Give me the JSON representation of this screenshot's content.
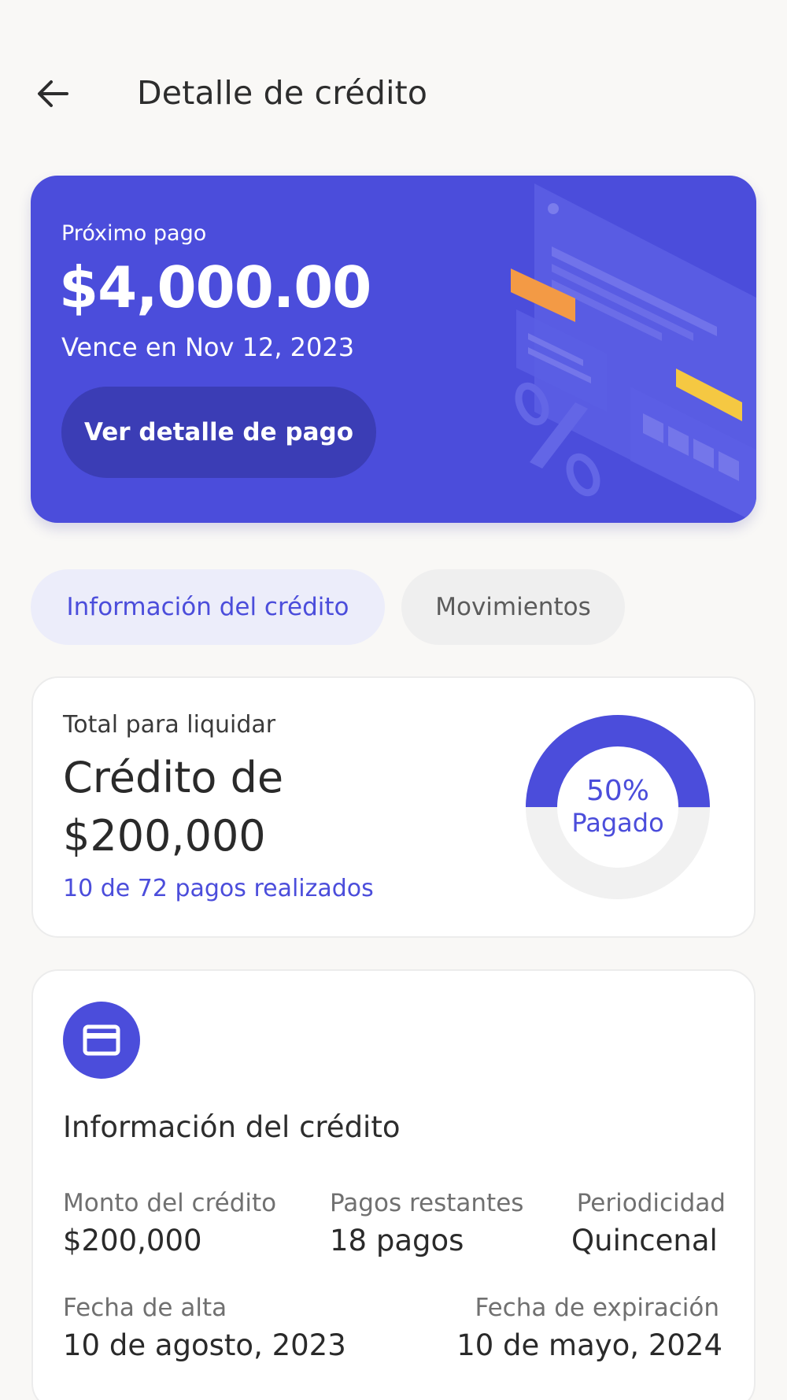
{
  "header": {
    "title": "Detalle de crédito",
    "back_icon": "arrow-left-icon"
  },
  "hero": {
    "label": "Próximo pago",
    "amount": "$4,000.00",
    "due": "Vence en Nov 12, 2023",
    "button_label": "Ver detalle de pago",
    "background_color": "#4b4ddb",
    "button_color": "#3b3db5"
  },
  "tabs": [
    {
      "label": "Información del crédito",
      "active": true
    },
    {
      "label": "Movimientos",
      "active": false
    }
  ],
  "summary": {
    "label": "Total para liquidar",
    "title": "Crédito de $200,000",
    "progress_text": "10 de 72 pagos realizados",
    "donut": {
      "percent_text": "50%",
      "label": "Pagado",
      "fraction_paid": 0.5
    }
  },
  "info": {
    "icon": "credit-card-icon",
    "title": "Información del crédito",
    "fields": [
      {
        "label": "Monto del crédito",
        "value": "$200,000"
      },
      {
        "label": "Pagos restantes",
        "value": "18 pagos"
      },
      {
        "label": "Periodicidad",
        "value": "Quincenal"
      },
      {
        "label": "Fecha de alta",
        "value": "10 de agosto, 2023"
      },
      {
        "label": "Fecha de expiración",
        "value": "10 de mayo, 2024"
      }
    ]
  },
  "colors": {
    "accent": "#4b4ddb",
    "background": "#f9f8f6",
    "tab_active_bg": "#ecedfa",
    "tab_inactive_bg": "#efefef",
    "donut_track": "#f1f1f1"
  }
}
